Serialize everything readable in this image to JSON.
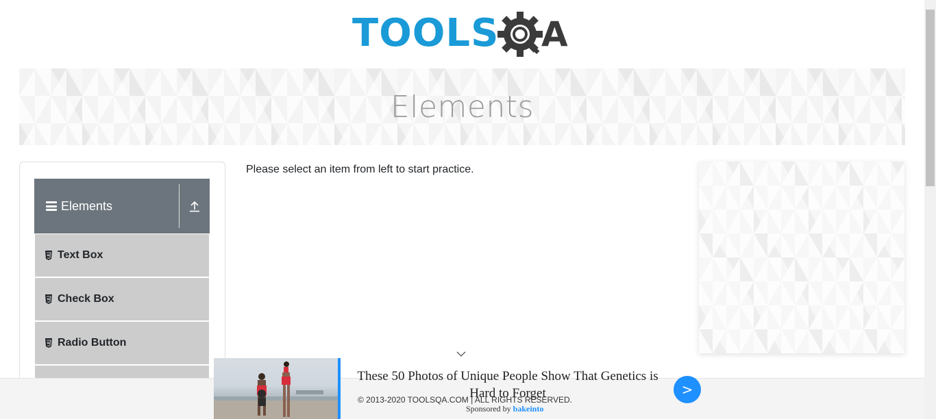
{
  "header": {
    "logo_text_left": "TOOLS",
    "logo_text_right": "QA",
    "logo_colors": {
      "blue": "#1a9ad7",
      "dark": "#3b3b3b"
    }
  },
  "banner": {
    "title": "Elements"
  },
  "sidebar": {
    "group": {
      "title": "Elements",
      "icon": "hamburger-icon",
      "collapse_icon": "upload-arrow-icon"
    },
    "items": [
      {
        "label": "Text Box",
        "icon": "html5-icon"
      },
      {
        "label": "Check Box",
        "icon": "html5-icon"
      },
      {
        "label": "Radio Button",
        "icon": "html5-icon"
      }
    ]
  },
  "main": {
    "message": "Please select an item from left to start practice."
  },
  "footer": {
    "copyright": "© 2013-2020 TOOLSQA.COM | ALL RIGHTS RESERVED."
  },
  "bottom_ad": {
    "headline": "These 50 Photos of Unique People Show That Genetics is Hard to Forget",
    "sponsored_prefix": "Sponsored by",
    "sponsor": "bakeinto",
    "next_label": ">",
    "accent_color": "#1e90ff"
  }
}
